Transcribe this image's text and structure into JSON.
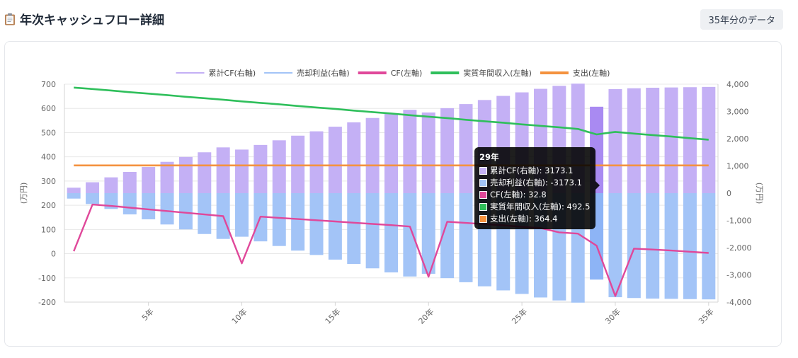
{
  "header": {
    "title": "年次キャッシュフロー詳細",
    "badge": "35年分のデータ"
  },
  "colors": {
    "cumulative_cf": "#c4b0f5",
    "cumulative_cf_active": "#a98af2",
    "sale_profit": "#a3c4f7",
    "sale_profit_active": "#8db4f6",
    "cf": "#e0489a",
    "income": "#2fbf5b",
    "expense": "#f4923f"
  },
  "chart_data": {
    "type": "bar",
    "x": [
      1,
      2,
      3,
      4,
      5,
      6,
      7,
      8,
      9,
      10,
      11,
      12,
      13,
      14,
      15,
      16,
      17,
      18,
      19,
      20,
      21,
      22,
      23,
      24,
      25,
      26,
      27,
      28,
      29,
      30,
      31,
      32,
      33,
      34,
      35
    ],
    "x_tick_labels": [
      "5年",
      "10年",
      "15年",
      "20年",
      "25年",
      "30年",
      "35年"
    ],
    "x_tick_values": [
      5,
      10,
      15,
      20,
      25,
      30,
      35
    ],
    "y_left": {
      "label": "(万円)",
      "ylim": [
        -200,
        700
      ],
      "ticks": [
        "700",
        "600",
        "500",
        "400",
        "300",
        "200",
        "100",
        "0",
        "-100",
        "-200"
      ]
    },
    "y_right": {
      "label": "(万円)",
      "ylim": [
        -4000,
        4000
      ],
      "ticks": [
        "4,000",
        "3,000",
        "2,000",
        "1,000",
        "0",
        "-1,000",
        "-2,000",
        "-3,000",
        "-4,000"
      ]
    },
    "legend_position": "top",
    "series": [
      {
        "name": "累計CF(右軸)",
        "kind": "bar",
        "axis": "right",
        "values": [
          200,
          400,
          580,
          780,
          960,
          1150,
          1330,
          1500,
          1680,
          1600,
          1770,
          1940,
          2110,
          2270,
          2440,
          2600,
          2760,
          2910,
          3060,
          2960,
          3120,
          3270,
          3420,
          3570,
          3700,
          3830,
          3940,
          4020,
          3173.1,
          3820,
          3850,
          3870,
          3880,
          3890,
          3900
        ]
      },
      {
        "name": "売却利益(右軸)",
        "kind": "bar",
        "axis": "right",
        "values": [
          -200,
          -400,
          -580,
          -780,
          -960,
          -1150,
          -1330,
          -1500,
          -1680,
          -1600,
          -1770,
          -1940,
          -2110,
          -2270,
          -2440,
          -2600,
          -2760,
          -2910,
          -3060,
          -2960,
          -3120,
          -3270,
          -3420,
          -3570,
          -3700,
          -3830,
          -3940,
          -4020,
          -3173.1,
          -3820,
          -3850,
          -3870,
          -3880,
          -3890,
          -3900
        ]
      },
      {
        "name": "CF(左軸)",
        "kind": "line",
        "axis": "left",
        "values": [
          10,
          203,
          197,
          190,
          183,
          176,
          169,
          162,
          155,
          -40,
          153,
          148,
          143,
          138,
          133,
          128,
          123,
          118,
          112,
          -95,
          132,
          127,
          122,
          117,
          111,
          106,
          88,
          83,
          32.8,
          -175,
          21,
          17,
          13,
          8,
          3
        ]
      },
      {
        "name": "実質年間収入(左軸)",
        "kind": "line",
        "axis": "left",
        "values": [
          686,
          680,
          674,
          667,
          661,
          655,
          648,
          642,
          636,
          629,
          623,
          617,
          610,
          604,
          598,
          591,
          585,
          579,
          572,
          566,
          560,
          553,
          547,
          541,
          534,
          528,
          522,
          515,
          492.5,
          503,
          496,
          490,
          484,
          477,
          471
        ]
      },
      {
        "name": "支出(左軸)",
        "kind": "line",
        "axis": "left",
        "values": [
          364.4,
          364.4,
          364.4,
          364.4,
          364.4,
          364.4,
          364.4,
          364.4,
          364.4,
          364.4,
          364.4,
          364.4,
          364.4,
          364.4,
          364.4,
          364.4,
          364.4,
          364.4,
          364.4,
          364.4,
          364.4,
          364.4,
          364.4,
          364.4,
          364.4,
          364.4,
          364.4,
          364.4,
          364.4,
          364.4,
          364.4,
          364.4,
          364.4,
          364.4,
          364.4
        ]
      }
    ],
    "tooltip": {
      "title": "29年",
      "active_index": 28,
      "rows": [
        "累計CF(右軸): 3173.1",
        "売却利益(右軸): -3173.1",
        "CF(左軸): 32.8",
        "実質年間収入(左軸): 492.5",
        "支出(左軸): 364.4"
      ]
    }
  }
}
